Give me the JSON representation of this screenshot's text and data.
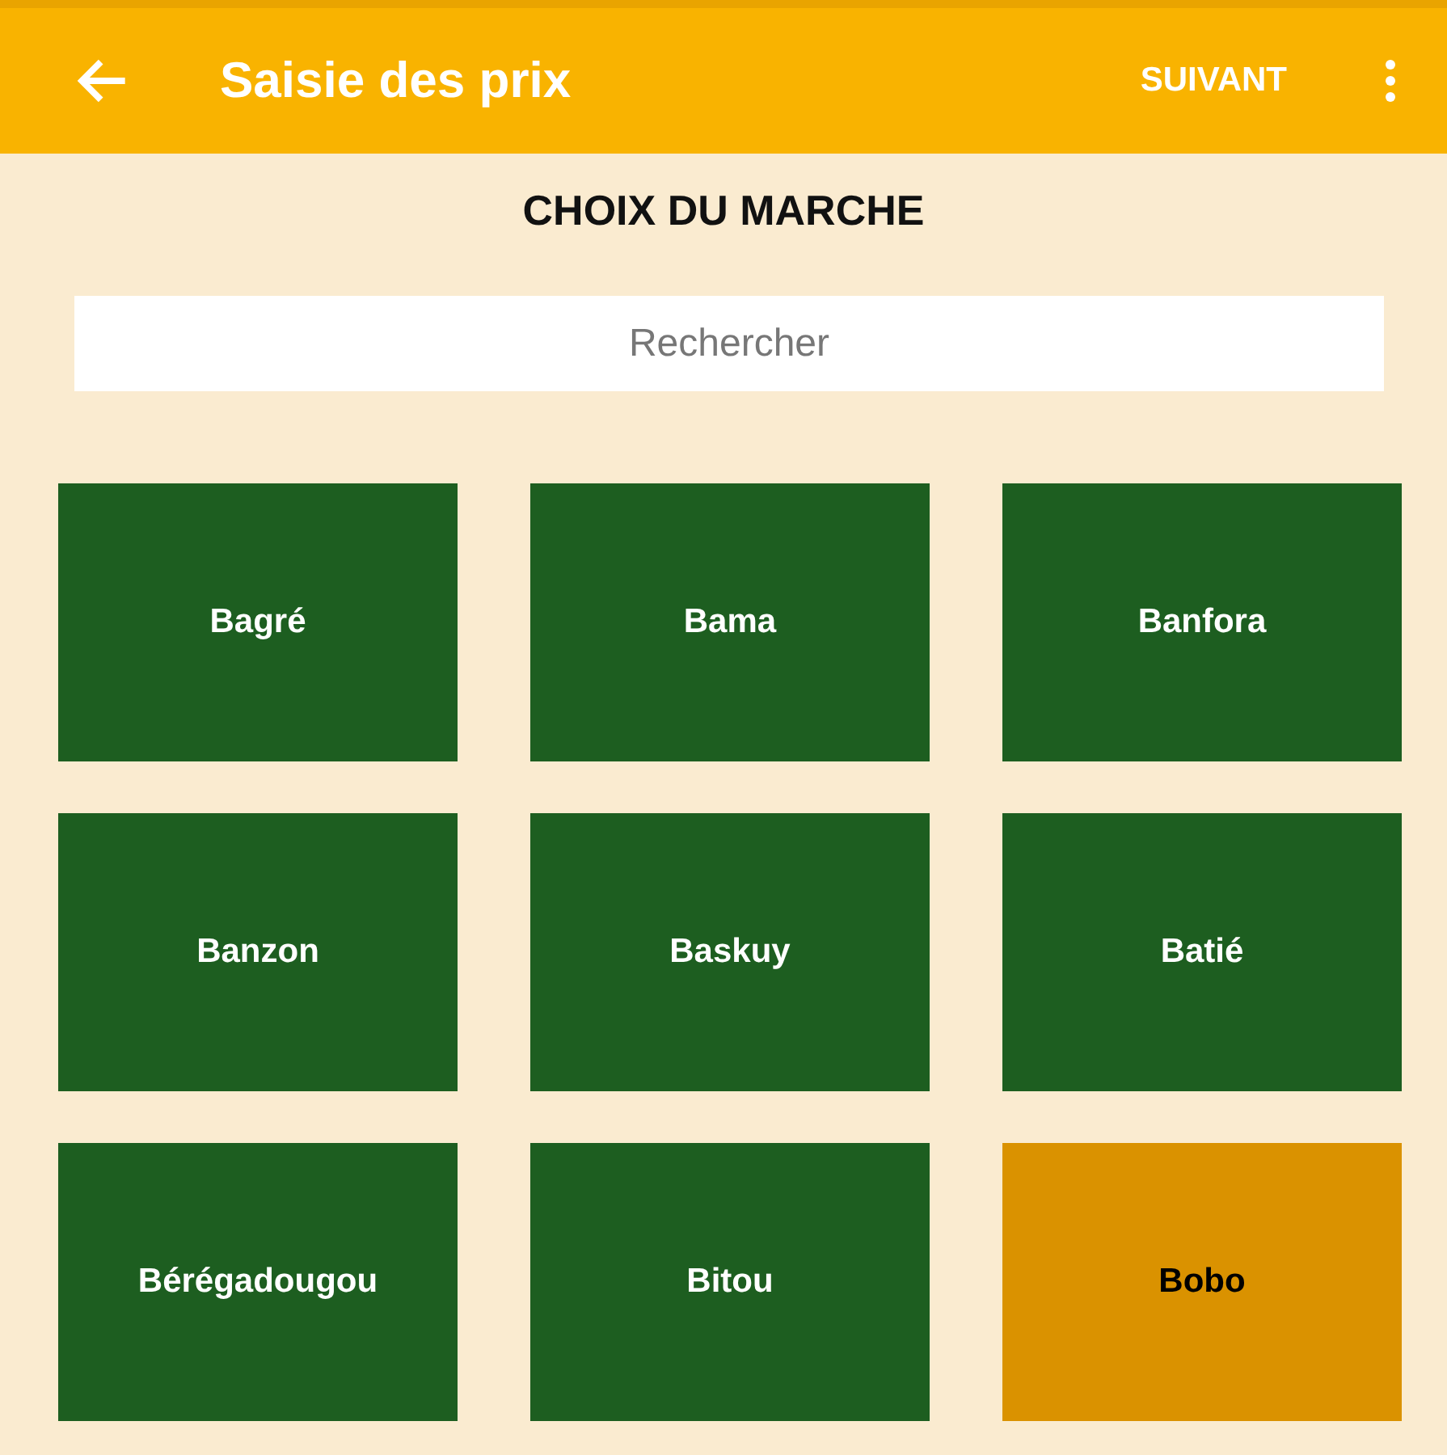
{
  "app_bar": {
    "title": "Saisie des prix",
    "action": "SUIVANT"
  },
  "heading": "CHOIX DU MARCHE",
  "search": {
    "placeholder": "Rechercher"
  },
  "markets": [
    {
      "name": "Bagré",
      "selected": false
    },
    {
      "name": "Bama",
      "selected": false
    },
    {
      "name": "Banfora",
      "selected": false
    },
    {
      "name": "Banzon",
      "selected": false
    },
    {
      "name": "Baskuy",
      "selected": false
    },
    {
      "name": "Batié",
      "selected": false
    },
    {
      "name": "Bérégadougou",
      "selected": false
    },
    {
      "name": "Bitou",
      "selected": false
    },
    {
      "name": "Bobo",
      "selected": true
    }
  ]
}
